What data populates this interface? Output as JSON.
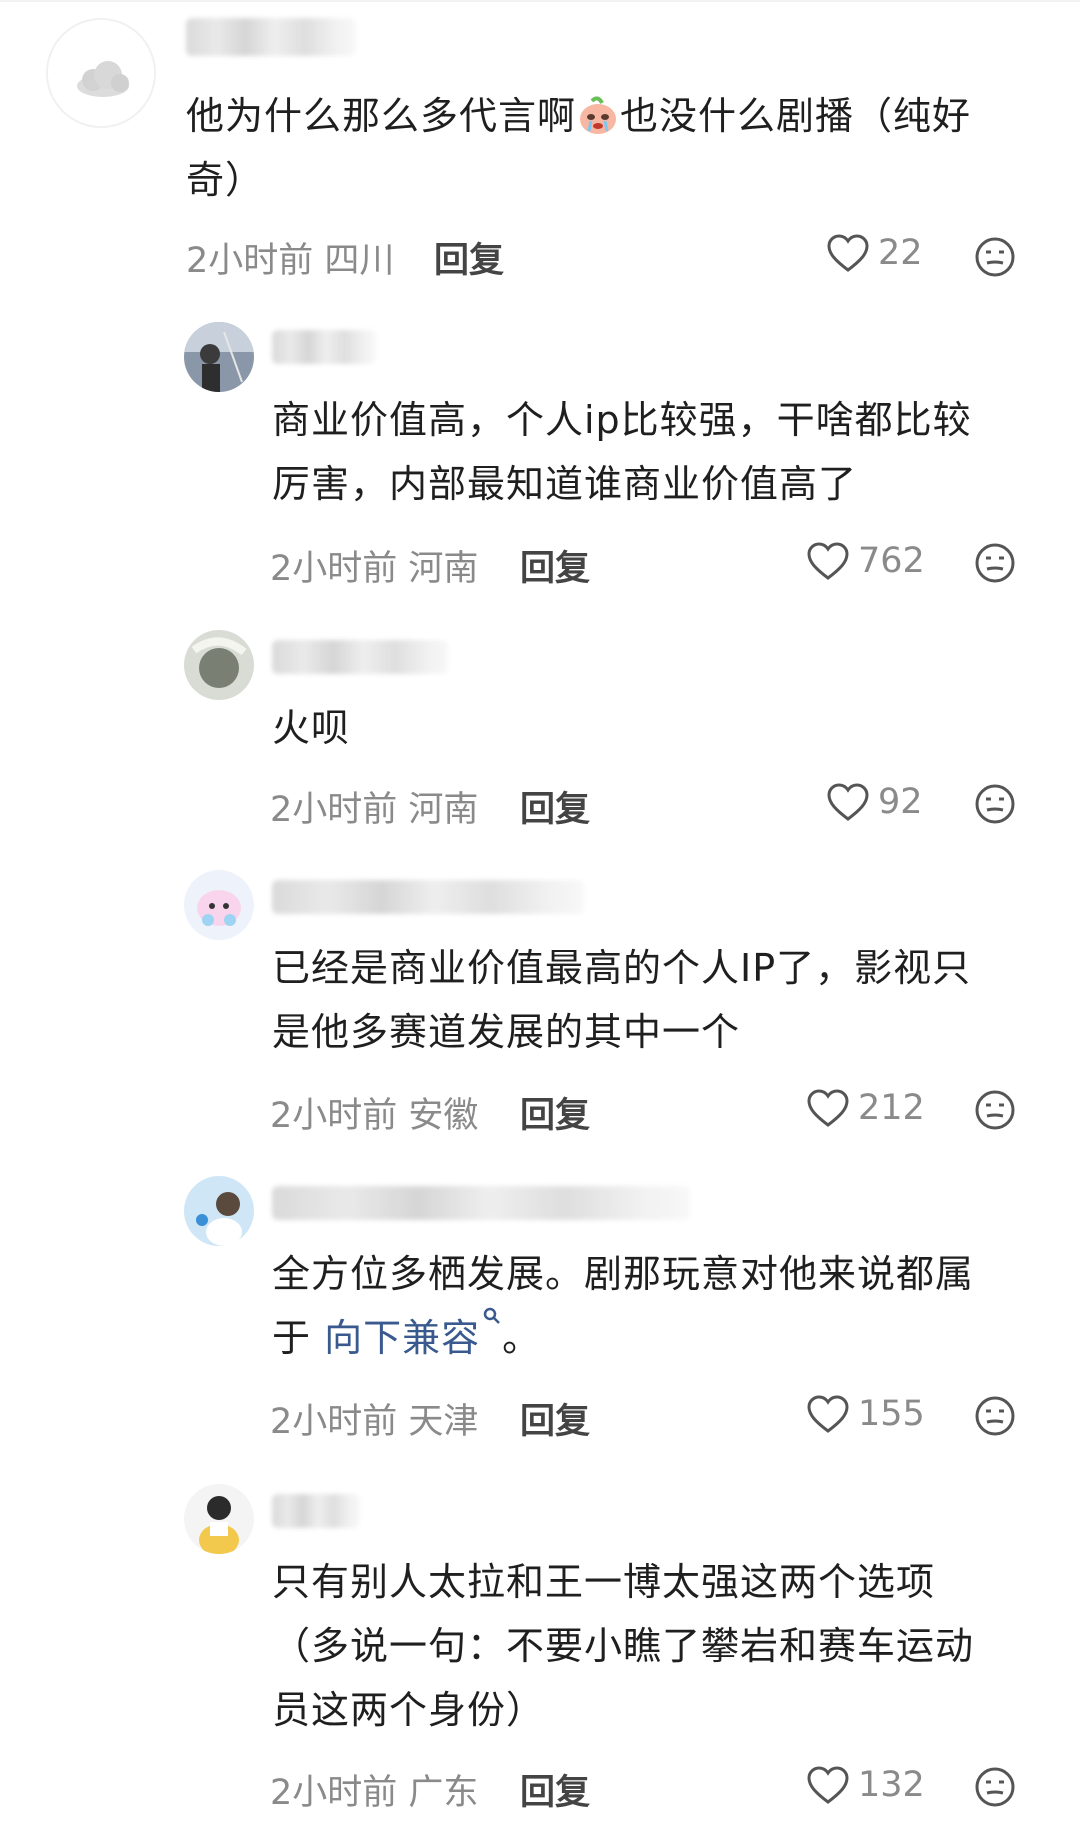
{
  "comments": [
    {
      "text": "他为什么那么多代言啊🥹也没什么剧播（纯好奇）",
      "text_parts": [
        "他为什么那么多代言啊",
        "也没什么剧播（纯好",
        "奇）"
      ],
      "time": "2小时前",
      "location": "四川",
      "reply": "回复",
      "likes": "22",
      "avatar": "cloud-avatar"
    },
    {
      "text_line1": "商业价值高，个人ip比较强，干啥都比较",
      "text_line2": "厉害，内部最知道谁商业价值高了",
      "time": "2小时前",
      "location": "河南",
      "reply": "回复",
      "likes": "762",
      "avatar": "photo-avatar"
    },
    {
      "text_line1": "火呗",
      "time": "2小时前",
      "location": "河南",
      "reply": "回复",
      "likes": "92",
      "avatar": "photo-avatar"
    },
    {
      "text_line1": "已经是商业价值最高的个人IP了，影视只",
      "text_line2": "是他多赛道发展的其中一个",
      "time": "2小时前",
      "location": "安徽",
      "reply": "回复",
      "likes": "212",
      "avatar": "cartoon-avatar"
    },
    {
      "text_line1": "全方位多栖发展。剧那玩意对他来说都属",
      "text_line2_prefix": "于 ",
      "text_line2_link": "向下兼容",
      "text_line2_suffix": "。",
      "time": "2小时前",
      "location": "天津",
      "reply": "回复",
      "likes": "155",
      "avatar": "photo-avatar"
    },
    {
      "text_line1": "只有别人太拉和王一博太强这两个选项",
      "text_line2": "（多说一句：不要小瞧了攀岩和赛车运动",
      "text_line3": "员这两个身份）",
      "time": "2小时前",
      "location": "广东",
      "reply": "回复",
      "likes": "132",
      "avatar": "photo-avatar"
    }
  ],
  "icons": {
    "like": "heart-outline-icon",
    "reaction": "emoji-face-icon",
    "search_link": "search-icon"
  },
  "colors": {
    "text": "#1f1f1f",
    "meta": "#8a8a8a",
    "link": "#3a5a8f",
    "background": "#ffffff"
  }
}
